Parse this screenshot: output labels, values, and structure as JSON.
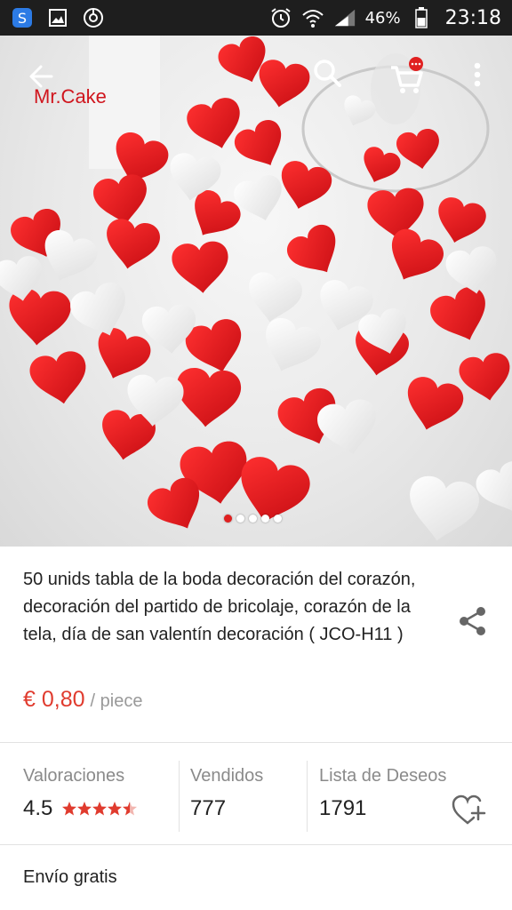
{
  "status_bar": {
    "battery": "46%",
    "time": "23:18"
  },
  "header": {
    "brand": "Mr.Cake"
  },
  "carousel": {
    "page_count": 5,
    "active_index": 0
  },
  "product": {
    "title": "50 unids tabla de la boda decoración del corazón, decoración del partido de bricolaje, corazón de la tela, día de san valentín decoración ( JCO-H11 )",
    "price": "€ 0,80",
    "unit": "/ piece"
  },
  "stats": {
    "ratings_label": "Valoraciones",
    "ratings_value": "4.5",
    "ratings_stars": 4.5,
    "sold_label": "Vendidos",
    "sold_value": "777",
    "wishlist_label": "Lista de Deseos",
    "wishlist_value": "1791"
  },
  "shipping": {
    "label": "Envío gratis"
  },
  "colors": {
    "accent": "#e03b2e",
    "statusbar": "#1e1e1e"
  },
  "icons": [
    "s-app-icon",
    "gallery-icon",
    "clock-app-icon",
    "alarm-icon",
    "wifi-icon",
    "signal-icon",
    "battery-icon",
    "back-arrow-icon",
    "search-icon",
    "cart-icon",
    "more-vert-icon",
    "share-icon",
    "heart-plus-icon",
    "star-icon"
  ]
}
